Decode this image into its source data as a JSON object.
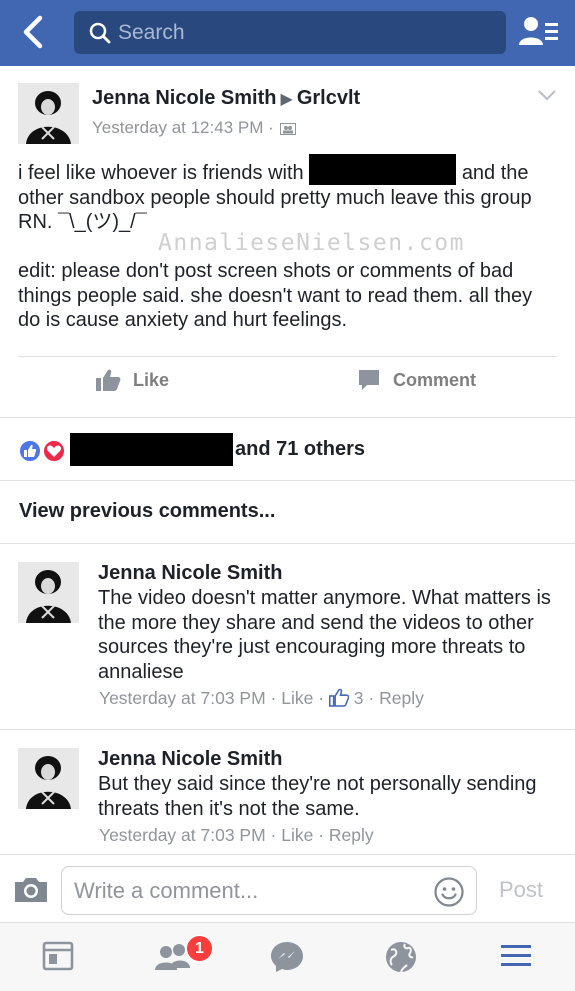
{
  "header": {
    "search_placeholder": "Search",
    "accent_color": "#4267b2"
  },
  "post": {
    "author": "Jenna Nicole Smith",
    "group": "Grlcvlt",
    "timestamp": "Yesterday at 12:43 PM",
    "body_line1_before": "i feel like whoever is friends with",
    "body_line1_after": "and",
    "body_rest": "the other sandbox people should pretty much leave this group RN. ¯\\_(ツ)_/¯",
    "watermark": "AnnalieseNielsen.com",
    "edit_text": "edit: please don't post screen shots or comments of bad things people said. she doesn't want to read them. all they do is cause anxiety and hurt feelings.",
    "actions": {
      "like": "Like",
      "comment": "Comment"
    },
    "reactions_text": "and 71 others"
  },
  "view_previous": "View previous comments...",
  "comments": [
    {
      "author": "Jenna Nicole Smith",
      "text": "The video doesn't matter anymore. What matters is the more they share and send the videos to other sources they're just encouraging more threats to annaliese",
      "time": "Yesterday at 7:03 PM",
      "like_label": "Like",
      "like_count": "3",
      "reply_label": "Reply"
    },
    {
      "author": "Jenna Nicole Smith",
      "text": "But they said since they're not personally sending threats then it's not the same.",
      "time": "Yesterday at 7:03 PM",
      "like_label": "Like",
      "reply_label": "Reply"
    }
  ],
  "composer": {
    "placeholder": "Write a comment...",
    "post_label": "Post"
  },
  "bottom_nav": {
    "items": [
      "news-feed-icon",
      "friend-requests-icon",
      "messenger-icon",
      "notifications-globe-icon",
      "menu-icon"
    ],
    "friend_requests_badge": "1"
  }
}
